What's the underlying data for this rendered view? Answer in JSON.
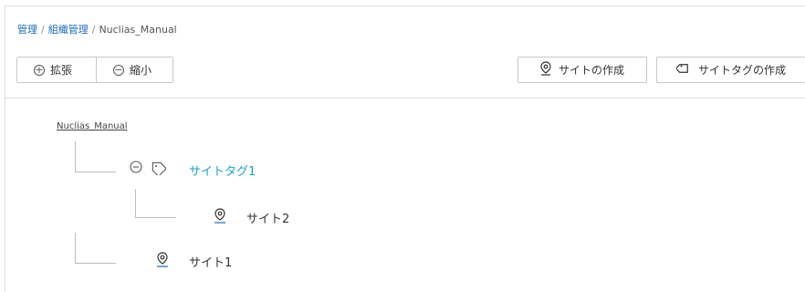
{
  "breadcrumb": {
    "items": [
      "管理",
      "組織管理",
      "Nuclias_Manual"
    ],
    "separator": "/"
  },
  "toolbar": {
    "expand_label": "拡張",
    "collapse_label": "縮小",
    "create_site_label": "サイトの作成",
    "create_sitetag_label": "サイトタグの作成"
  },
  "tree": {
    "root": "Nuclias_Manual",
    "sitetag": {
      "label": "サイトタグ1",
      "children": [
        "サイト2"
      ]
    },
    "sites": [
      "サイト1"
    ]
  },
  "colors": {
    "accent": "#1aa3c9",
    "link": "#1e6bb8",
    "border": "#c8c8c8"
  },
  "icons": {
    "expand": "plus-circle-icon",
    "collapse": "minus-circle-icon",
    "site": "location-pin-icon",
    "tag": "tag-icon"
  }
}
